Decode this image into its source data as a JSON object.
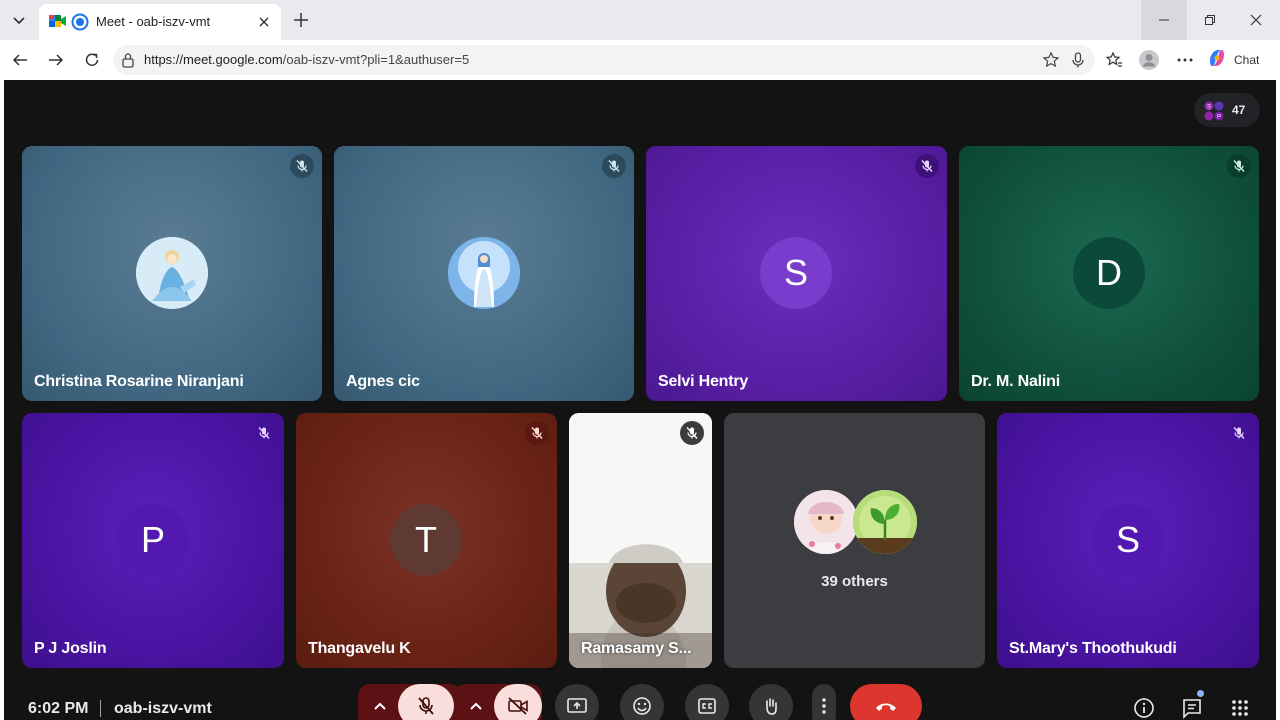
{
  "browser": {
    "tab_title": "Meet - oab-iszv-vmt",
    "url_host": "https://meet.google.com",
    "url_path": "/oab-iszv-vmt?pli=1&authuser=5",
    "chat_label": "Chat"
  },
  "meet": {
    "participant_count": "47",
    "tiles": [
      {
        "name": "Christina Rosarine Niranjani",
        "bg": "#4b6d86",
        "avatar": "photo-cinderella"
      },
      {
        "name": "Agnes cic",
        "bg": "#4b6d86",
        "avatar": "photo-mary"
      },
      {
        "name": "Selvi Hentry",
        "bg": "#5a1fa6",
        "initial": "S"
      },
      {
        "name": "Dr. M. Nalini",
        "bg": "#0f4f3c",
        "initial": "D"
      },
      {
        "name": "P J Joslin",
        "bg": "#4a14a3",
        "initial": "P"
      },
      {
        "name": "Thangavelu K",
        "bg": "#6a2416",
        "initial": "T"
      },
      {
        "name": "Ramasamy S...",
        "bg": "#f5f5f5",
        "avatar": "video-feed"
      },
      {
        "name": "St.Mary's Thoothukudi",
        "bg": "#4a14a3",
        "initial": "S"
      }
    ],
    "others_label": "39 others",
    "time": "6:02 PM",
    "meeting_code": "oab-iszv-vmt"
  },
  "colors": {
    "end_call": "#dc362e",
    "mic_off_bg": "#f9dedc",
    "ctl_bg": "#333537"
  }
}
